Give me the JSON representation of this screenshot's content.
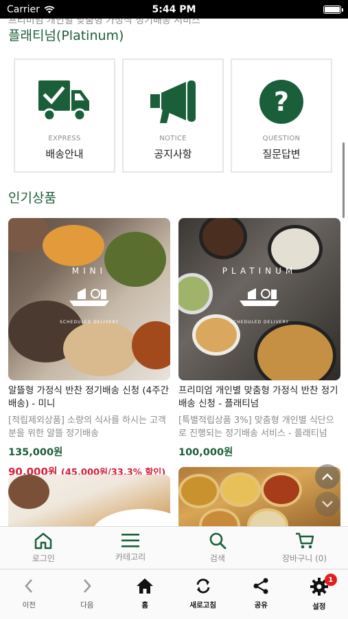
{
  "status_bar": {
    "carrier": "Carrier",
    "time": "5:44 PM"
  },
  "cut_text": "프리미엄 개인별 맞춤형 가정식 정기배송 서비스",
  "section_title_platinum": "플래티넘(Platinum)",
  "info_cards": [
    {
      "icon": "truck-icon",
      "sub": "EXPRESS",
      "label": "배송안내"
    },
    {
      "icon": "megaphone-icon",
      "sub": "NOTICE",
      "label": "공지사항"
    },
    {
      "icon": "question-icon",
      "sub": "QUESTION",
      "label": "질문답변"
    }
  ],
  "section_title_popular": "인기상품",
  "products": [
    {
      "name": "알뜰형 가정식 반찬 정기배송 신청 (4주간 배송) - 미니",
      "desc": "[적립제외상품] 소량의 식사를 하시는 고객분을 위한 알뜰 정기배송",
      "price": "135,000원",
      "sale_price": "90,000원",
      "sale_note": "(45,000원/33.3% 할인)",
      "image_text": "MINI"
    },
    {
      "name": "프리미엄 개인별 맞춤형 가정식 반찬 정기배송 신청 - 플래티넘",
      "desc": "[특별적립상품 3%] 맞춤형 개인별 식단으로 진행되는 정기배송 서비스 - 플래티넘",
      "price": "100,000원",
      "image_text": "PLATINUM"
    }
  ],
  "tab_bar": [
    {
      "icon": "home-icon",
      "label": "로그인"
    },
    {
      "icon": "menu-icon",
      "label": "카테고리"
    },
    {
      "icon": "search-icon",
      "label": "검색"
    },
    {
      "icon": "cart-icon",
      "label": "장바구니 (0)"
    }
  ],
  "browser_bar": [
    {
      "icon": "chevron-left-icon",
      "label": "이전"
    },
    {
      "icon": "chevron-right-icon",
      "label": "다음"
    },
    {
      "icon": "home-icon",
      "label": "홈"
    },
    {
      "icon": "refresh-icon",
      "label": "새로고침"
    },
    {
      "icon": "share-icon",
      "label": "공유"
    },
    {
      "icon": "gear-icon",
      "label": "설정",
      "badge": "1"
    }
  ],
  "colors": {
    "brand_green": "#1b5e3a",
    "sale_red": "#d6203a",
    "badge_red": "#e02020"
  }
}
